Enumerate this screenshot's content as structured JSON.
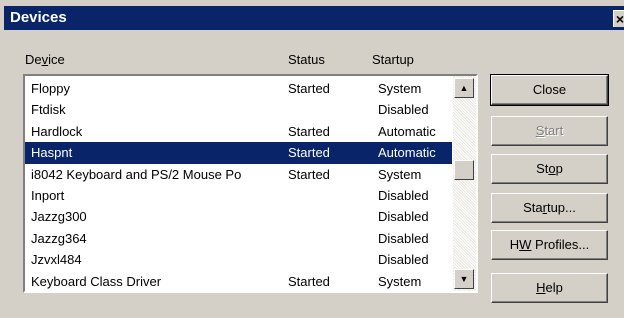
{
  "window": {
    "title": "Devices",
    "close_glyph": "×"
  },
  "columns": {
    "device_pre": "De",
    "device_acc": "v",
    "device_post": "ice",
    "status": "Status",
    "startup": "Startup"
  },
  "devices": [
    {
      "name": "Floppy",
      "status": "Started",
      "startup": "System"
    },
    {
      "name": "Ftdisk",
      "status": "",
      "startup": "Disabled"
    },
    {
      "name": "Hardlock",
      "status": "Started",
      "startup": "Automatic"
    },
    {
      "name": "Haspnt",
      "status": "Started",
      "startup": "Automatic"
    },
    {
      "name": "i8042 Keyboard and PS/2 Mouse Po",
      "status": "Started",
      "startup": "System"
    },
    {
      "name": "Inport",
      "status": "",
      "startup": "Disabled"
    },
    {
      "name": "Jazzg300",
      "status": "",
      "startup": "Disabled"
    },
    {
      "name": "Jazzg364",
      "status": "",
      "startup": "Disabled"
    },
    {
      "name": "Jzvxl484",
      "status": "",
      "startup": "Disabled"
    },
    {
      "name": "Keyboard Class Driver",
      "status": "Started",
      "startup": "System"
    }
  ],
  "selected_device": "Haspnt",
  "buttons": {
    "close": "Close",
    "start_acc": "S",
    "start_rest": "tart",
    "stop_pre": "St",
    "stop_acc": "o",
    "stop_post": "p",
    "startup_pre": "Sta",
    "startup_acc": "r",
    "startup_post": "tup...",
    "hw_pre": "H",
    "hw_acc": "W",
    "hw_post": " Profiles...",
    "help_acc": "H",
    "help_rest": "elp"
  },
  "icons": {
    "scroll_up": "▲",
    "scroll_down": "▼"
  }
}
